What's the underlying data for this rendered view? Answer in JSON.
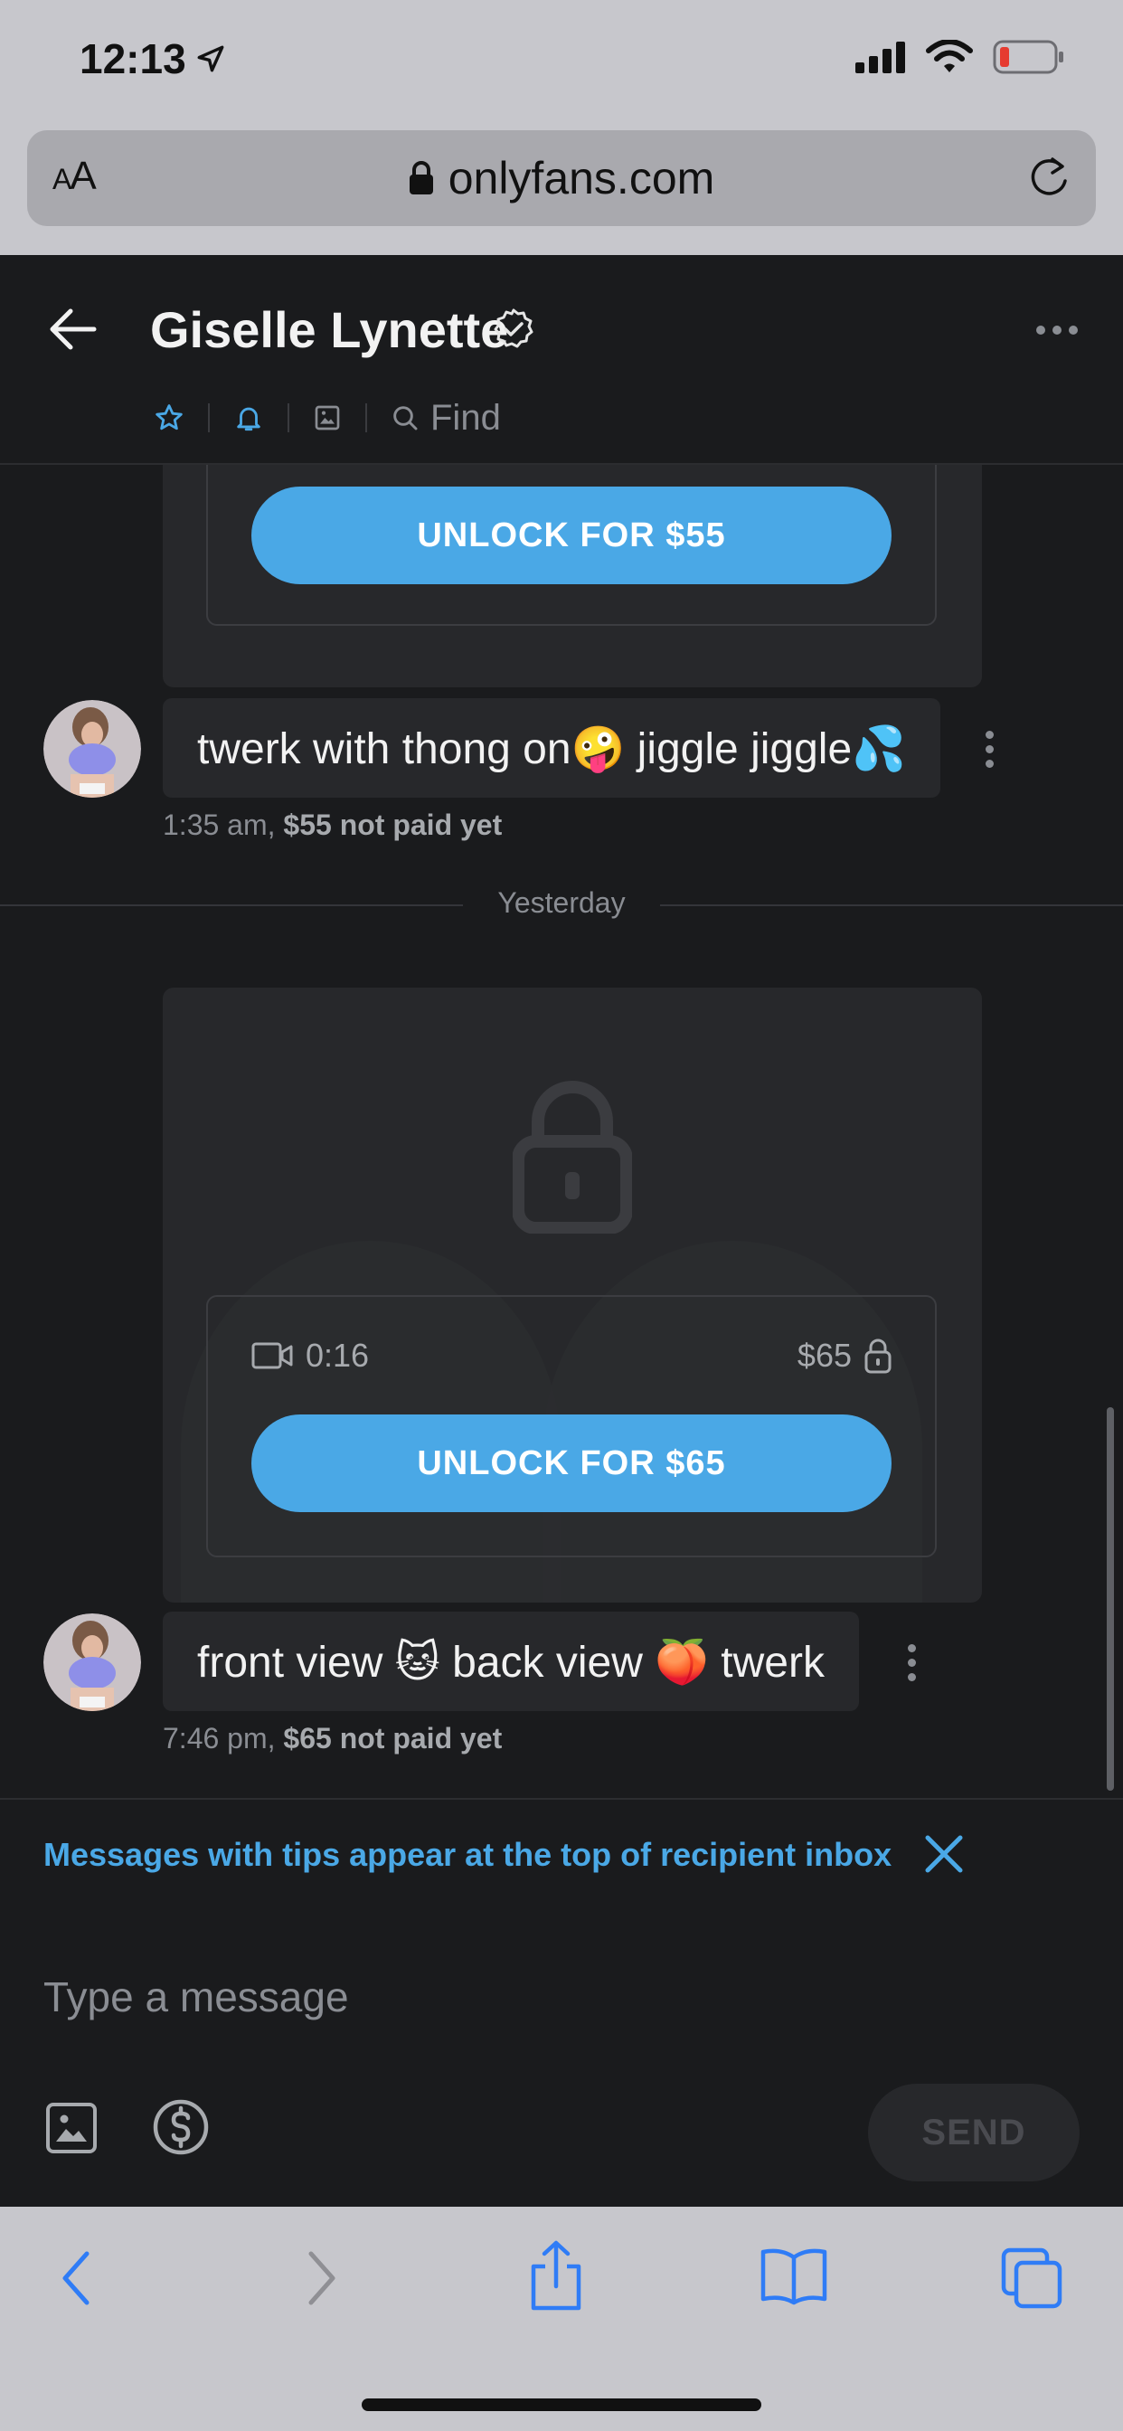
{
  "status_bar": {
    "time": "12:13",
    "icons": [
      "location-arrow-icon",
      "cellular-signal-icon",
      "wifi-icon",
      "battery-low-icon"
    ]
  },
  "browser": {
    "text_size_label": "AA",
    "url": "onlyfans.com",
    "icons": [
      "lock-icon",
      "reload-icon"
    ]
  },
  "chat_header": {
    "contact_name": "Giselle Lynette",
    "verified": true,
    "tabs": [
      {
        "name": "favorite",
        "icon": "star-icon"
      },
      {
        "name": "notifications",
        "icon": "bell-icon"
      },
      {
        "name": "media",
        "icon": "image-icon"
      },
      {
        "name": "find",
        "icon": "search-icon",
        "label": "Find"
      }
    ],
    "accent_color": "#4aa8e6"
  },
  "messages": [
    {
      "type": "locked_media",
      "unlock_label": "UNLOCK FOR $55",
      "text": "twerk with thong on🤪 jiggle jiggle💦",
      "time": "1:35 am,",
      "payment_status": "$55 not paid yet"
    },
    {
      "type": "date_divider",
      "label": "Yesterday"
    },
    {
      "type": "locked_media",
      "media_kind": "video",
      "duration": "0:16",
      "price": "$65",
      "unlock_label": "UNLOCK FOR $65",
      "text": "front view 🐱 back view 🍑 twerk",
      "time": "7:46 pm,",
      "payment_status": "$65 not paid yet"
    }
  ],
  "tip_banner": {
    "text": "Messages with tips appear at the top of recipient inbox"
  },
  "composer": {
    "placeholder": "Type a message",
    "send_label": "SEND"
  },
  "safari_toolbar": {
    "buttons": [
      "back-icon",
      "forward-icon",
      "share-icon",
      "bookmarks-icon",
      "tabs-icon"
    ]
  },
  "colors": {
    "background": "#1a1b1d",
    "card": "#27282b",
    "accent": "#4aa8e6",
    "browser_chrome": "#c7c7cc"
  }
}
